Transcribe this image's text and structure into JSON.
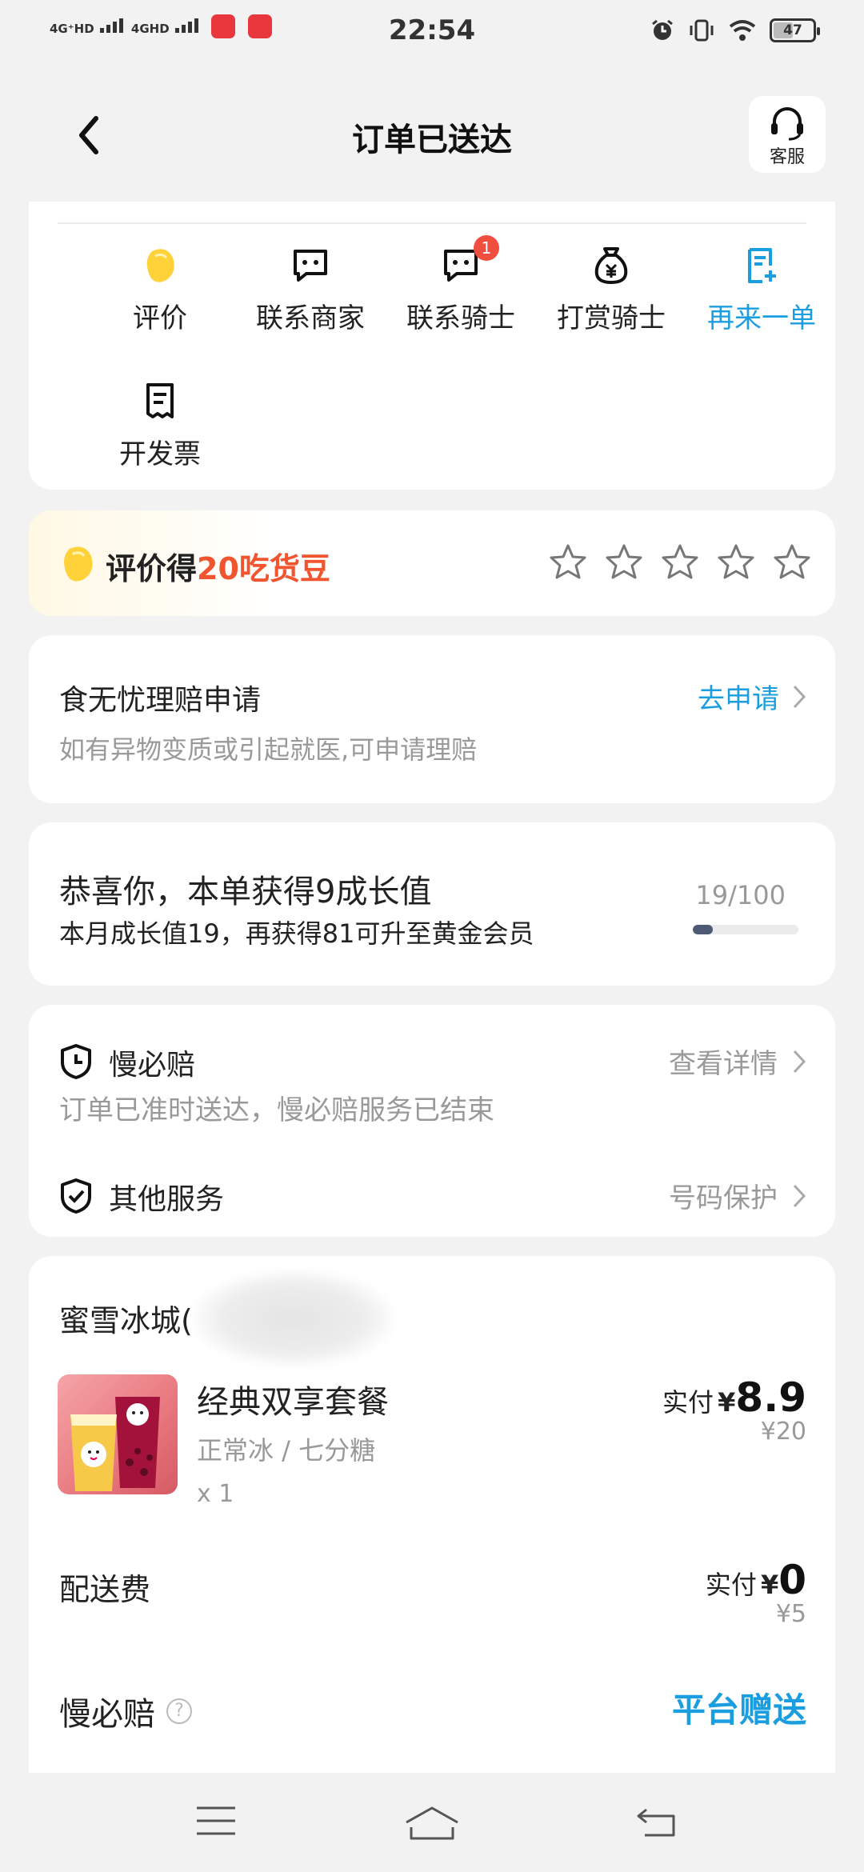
{
  "status_bar": {
    "signal1": "4G⁺HD",
    "signal2": "4GHD",
    "time": "22:54",
    "battery": "47"
  },
  "header": {
    "title": "订单已送达",
    "service_label": "客服"
  },
  "actions": [
    {
      "label": "评价",
      "icon": "bean-icon"
    },
    {
      "label": "联系商家",
      "icon": "chat-icon"
    },
    {
      "label": "联系骑士",
      "icon": "chat-icon",
      "badge": "1"
    },
    {
      "label": "打赏骑士",
      "icon": "money-bag-icon"
    },
    {
      "label": "再来一单",
      "icon": "reorder-icon",
      "color": "#1a9ee0"
    },
    {
      "label": "开发票",
      "icon": "receipt-icon"
    }
  ],
  "review": {
    "prefix": "评价得",
    "reward": "20吃货豆",
    "stars": 5,
    "accent_color": "#f0552f"
  },
  "claim": {
    "title": "食无忧理赔申请",
    "subtitle": "如有异物变质或引起就医,可申请理赔",
    "link": "去申请"
  },
  "growth": {
    "title": "恭喜你，本单获得9成长值",
    "subtitle": "本月成长值19，再获得81可升至黄金会员",
    "count": "19/100",
    "progress": 0.19
  },
  "services": {
    "slow_title": "慢必赔",
    "slow_link": "查看详情",
    "slow_note": "订单已准时送达，慢必赔服务已结束",
    "other_title": "其他服务",
    "other_link": "号码保护"
  },
  "order": {
    "shop_name": "蜜雪冰城(",
    "product": {
      "name": "经典双享套餐",
      "spec": "正常冰 / 七分糖",
      "qty": "x 1",
      "paid_label": "实付",
      "yen": "¥",
      "paid": "8.9",
      "original": "¥20"
    },
    "delivery": {
      "name": "配送费",
      "paid_label": "实付",
      "yen": "¥",
      "paid": "0",
      "original": "¥5"
    },
    "slow": {
      "name": "慢必赔",
      "help": "?",
      "value": "平台赠送"
    }
  },
  "colors": {
    "accent_blue": "#1a9ee0",
    "bean_yellow": "#ffd23a"
  }
}
